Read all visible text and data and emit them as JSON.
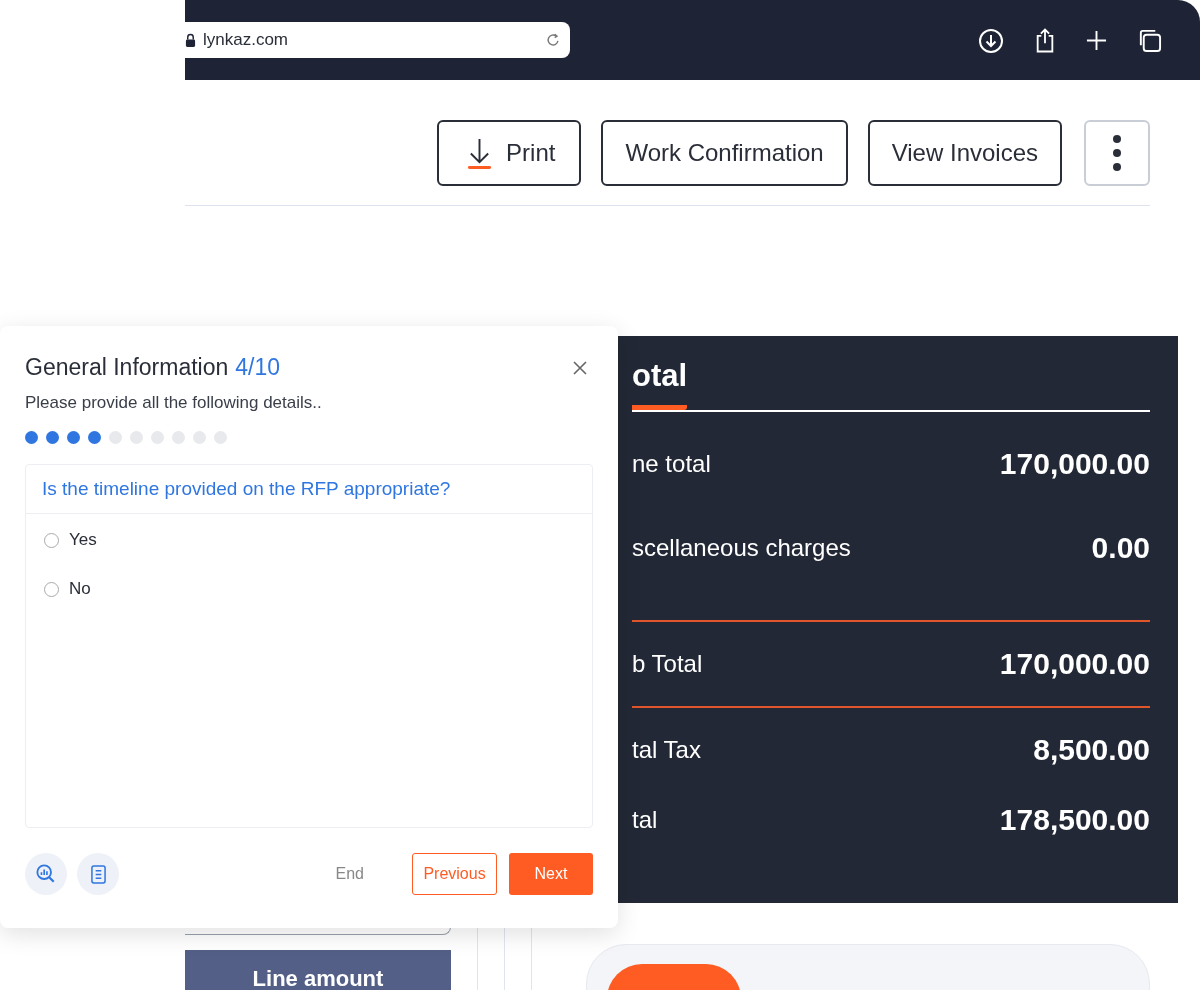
{
  "browser": {
    "url": "lynkaz.com"
  },
  "actions": [
    {
      "kind": "print",
      "label": "Print"
    },
    {
      "kind": "text",
      "label": "Work Confirmation"
    },
    {
      "kind": "text",
      "label": "View Invoices"
    },
    {
      "kind": "more"
    }
  ],
  "totals": {
    "title": "otal",
    "rows": [
      {
        "label": "ne total",
        "value": "170,000.00",
        "divider_before": false
      },
      {
        "label": "scellaneous charges",
        "value": "0.00",
        "divider_before": false
      },
      {
        "label": "b Total",
        "value": "170,000.00",
        "divider_before": true
      },
      {
        "label": "tal Tax",
        "value": "8,500.00",
        "divider_before": true
      },
      {
        "label": "tal",
        "value": "178,500.00",
        "divider_before": false
      }
    ]
  },
  "table": {
    "column_header": "Line amount"
  },
  "dialog": {
    "title": "General Information",
    "step": "4/10",
    "subtitle": "Please provide all the following details..",
    "steps": [
      {
        "done": true
      },
      {
        "done": true
      },
      {
        "done": true
      },
      {
        "done": true
      },
      {
        "done": false
      },
      {
        "done": false
      },
      {
        "done": false
      },
      {
        "done": false
      },
      {
        "done": false
      },
      {
        "done": false
      }
    ],
    "question": "Is the timeline provided on the RFP appropriate?",
    "options": [
      {
        "label": "Yes",
        "selected": false
      },
      {
        "label": "No",
        "selected": false
      }
    ],
    "end": "End",
    "previous": "Previous",
    "next": "Next"
  }
}
